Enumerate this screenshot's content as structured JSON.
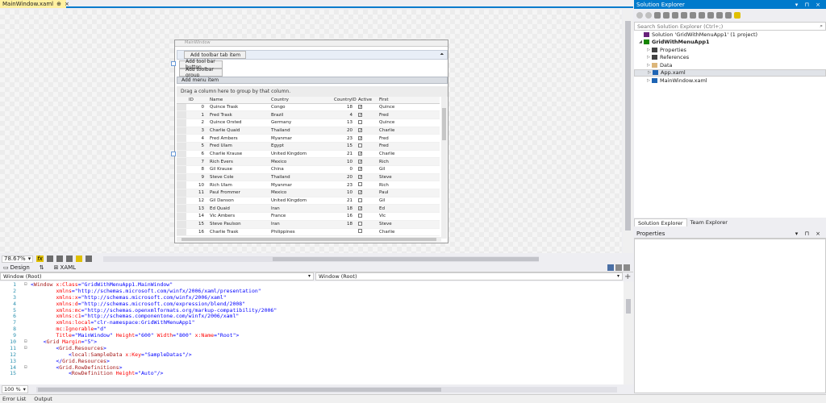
{
  "tabs": {
    "doc_tab": "MainWindow.xaml",
    "pin": "⊕",
    "close": "×"
  },
  "designer": {
    "window_title": "MainWindow",
    "toolbar_tab": "Add toolbar tab item",
    "toolbar_button": "Add tool bar button",
    "toolbar_group": "Add toolbar group",
    "menu_item": "Add menu item",
    "group_hint": "Drag a column here to group by that column.",
    "columns": [
      "ID",
      "Name",
      "Country",
      "CountryID",
      "Active",
      "First"
    ],
    "rows": [
      {
        "id": "0",
        "name": "Quince Trask",
        "country": "Congo",
        "cid": "18",
        "active": true,
        "first": "Quince"
      },
      {
        "id": "1",
        "name": "Fred Trask",
        "country": "Brazil",
        "cid": "4",
        "active": true,
        "first": "Fred"
      },
      {
        "id": "2",
        "name": "Quince Orsted",
        "country": "Germany",
        "cid": "13",
        "active": false,
        "first": "Quince"
      },
      {
        "id": "3",
        "name": "Charlie Quaid",
        "country": "Thailand",
        "cid": "20",
        "active": true,
        "first": "Charlie"
      },
      {
        "id": "4",
        "name": "Fred Ambers",
        "country": "Myanmar",
        "cid": "23",
        "active": true,
        "first": "Fred"
      },
      {
        "id": "5",
        "name": "Fred Ulam",
        "country": "Egypt",
        "cid": "15",
        "active": false,
        "first": "Fred"
      },
      {
        "id": "6",
        "name": "Charlie Krause",
        "country": "United Kingdom",
        "cid": "21",
        "active": true,
        "first": "Charlie"
      },
      {
        "id": "7",
        "name": "Rich Evers",
        "country": "Mexico",
        "cid": "10",
        "active": true,
        "first": "Rich"
      },
      {
        "id": "8",
        "name": "Gil Krause",
        "country": "China",
        "cid": "0",
        "active": true,
        "first": "Gil"
      },
      {
        "id": "9",
        "name": "Steve Cole",
        "country": "Thailand",
        "cid": "20",
        "active": true,
        "first": "Steve"
      },
      {
        "id": "10",
        "name": "Rich Ulam",
        "country": "Myanmar",
        "cid": "23",
        "active": false,
        "first": "Rich"
      },
      {
        "id": "11",
        "name": "Paul Frommer",
        "country": "Mexico",
        "cid": "10",
        "active": true,
        "first": "Paul"
      },
      {
        "id": "12",
        "name": "Gil Danson",
        "country": "United Kingdom",
        "cid": "21",
        "active": false,
        "first": "Gil"
      },
      {
        "id": "13",
        "name": "Ed Quaid",
        "country": "Iran",
        "cid": "18",
        "active": true,
        "first": "Ed"
      },
      {
        "id": "14",
        "name": "Vic Ambers",
        "country": "France",
        "cid": "16",
        "active": false,
        "first": "Vic"
      },
      {
        "id": "15",
        "name": "Steve Paulson",
        "country": "Iran",
        "cid": "18",
        "active": false,
        "first": "Steve"
      },
      {
        "id": "16",
        "name": "Charlie Trask",
        "country": "Philippines",
        "cid": "",
        "active": false,
        "first": "Charlie"
      }
    ]
  },
  "zoom": {
    "value": "78.67%",
    "fx": "fx"
  },
  "view_tabs": {
    "design": "Design",
    "swap": "⇅",
    "xaml": "XAML"
  },
  "selectors": {
    "left": "Window (Root)",
    "right": "Window (Root)"
  },
  "code_zoom": "100 %",
  "code_lines": [
    {
      "n": "1",
      "fold": "⊟",
      "indent": "",
      "parts": [
        [
          "pun",
          "<"
        ],
        [
          "tag",
          "Window"
        ],
        [
          "att",
          " x:Class"
        ],
        [
          "pun",
          "=\""
        ],
        [
          "val",
          "GridWithMenuApp1.MainWindow"
        ],
        [
          "pun",
          "\""
        ]
      ]
    },
    {
      "n": "2",
      "fold": "",
      "indent": "        ",
      "parts": [
        [
          "att",
          "xmlns"
        ],
        [
          "pun",
          "=\""
        ],
        [
          "val",
          "http://schemas.microsoft.com/winfx/2006/xaml/presentation"
        ],
        [
          "pun",
          "\""
        ]
      ]
    },
    {
      "n": "3",
      "fold": "",
      "indent": "        ",
      "parts": [
        [
          "att",
          "xmlns:x"
        ],
        [
          "pun",
          "=\""
        ],
        [
          "val",
          "http://schemas.microsoft.com/winfx/2006/xaml"
        ],
        [
          "pun",
          "\""
        ]
      ]
    },
    {
      "n": "4",
      "fold": "",
      "indent": "        ",
      "parts": [
        [
          "att",
          "xmlns:d"
        ],
        [
          "pun",
          "=\""
        ],
        [
          "val",
          "http://schemas.microsoft.com/expression/blend/2008"
        ],
        [
          "pun",
          "\""
        ]
      ]
    },
    {
      "n": "5",
      "fold": "",
      "indent": "        ",
      "parts": [
        [
          "att",
          "xmlns:mc"
        ],
        [
          "pun",
          "=\""
        ],
        [
          "val",
          "http://schemas.openxmlformats.org/markup-compatibility/2006"
        ],
        [
          "pun",
          "\""
        ]
      ]
    },
    {
      "n": "6",
      "fold": "",
      "indent": "        ",
      "parts": [
        [
          "att",
          "xmlns:c1"
        ],
        [
          "pun",
          "=\""
        ],
        [
          "val",
          "http://schemas.componentone.com/winfx/2006/xaml"
        ],
        [
          "pun",
          "\""
        ]
      ]
    },
    {
      "n": "7",
      "fold": "",
      "indent": "        ",
      "parts": [
        [
          "att",
          "xmlns:local"
        ],
        [
          "pun",
          "=\""
        ],
        [
          "val",
          "clr-namespace:GridWithMenuApp1"
        ],
        [
          "pun",
          "\""
        ]
      ]
    },
    {
      "n": "8",
      "fold": "",
      "indent": "        ",
      "parts": [
        [
          "att",
          "mc:Ignorable"
        ],
        [
          "pun",
          "=\""
        ],
        [
          "val",
          "d"
        ],
        [
          "pun",
          "\""
        ]
      ]
    },
    {
      "n": "9",
      "fold": "",
      "indent": "        ",
      "parts": [
        [
          "att",
          "Title"
        ],
        [
          "pun",
          "=\""
        ],
        [
          "val",
          "MainWindow"
        ],
        [
          "pun",
          "\""
        ],
        [
          "att",
          " Height"
        ],
        [
          "pun",
          "=\""
        ],
        [
          "val",
          "600"
        ],
        [
          "pun",
          "\""
        ],
        [
          "att",
          " Width"
        ],
        [
          "pun",
          "=\""
        ],
        [
          "val",
          "800"
        ],
        [
          "pun",
          "\""
        ],
        [
          "att",
          " x:Name"
        ],
        [
          "pun",
          "=\""
        ],
        [
          "val",
          "Root"
        ],
        [
          "pun",
          "\">"
        ]
      ]
    },
    {
      "n": "10",
      "fold": "⊟",
      "indent": "    ",
      "parts": [
        [
          "pun",
          "<"
        ],
        [
          "tag",
          "Grid"
        ],
        [
          "att",
          " Margin"
        ],
        [
          "pun",
          "=\""
        ],
        [
          "val",
          "5"
        ],
        [
          "pun",
          "\">"
        ]
      ]
    },
    {
      "n": "11",
      "fold": "⊟",
      "indent": "        ",
      "parts": [
        [
          "pun",
          "<"
        ],
        [
          "tag",
          "Grid.Resources"
        ],
        [
          "pun",
          ">"
        ]
      ]
    },
    {
      "n": "12",
      "fold": "",
      "indent": "            ",
      "parts": [
        [
          "pun",
          "<"
        ],
        [
          "tag",
          "local:SampleData"
        ],
        [
          "att",
          " x:Key"
        ],
        [
          "pun",
          "=\""
        ],
        [
          "val",
          "SampleDatas"
        ],
        [
          "pun",
          "\"/>"
        ]
      ]
    },
    {
      "n": "13",
      "fold": "",
      "indent": "        ",
      "parts": [
        [
          "pun",
          "</"
        ],
        [
          "tag",
          "Grid.Resources"
        ],
        [
          "pun",
          ">"
        ]
      ]
    },
    {
      "n": "14",
      "fold": "⊟",
      "indent": "        ",
      "parts": [
        [
          "pun",
          "<"
        ],
        [
          "tag",
          "Grid.RowDefinitions"
        ],
        [
          "pun",
          ">"
        ]
      ]
    },
    {
      "n": "15",
      "fold": "",
      "indent": "            ",
      "parts": [
        [
          "pun",
          "<"
        ],
        [
          "tag",
          "RowDefinition"
        ],
        [
          "att",
          " Height"
        ],
        [
          "pun",
          "=\""
        ],
        [
          "val",
          "Auto"
        ],
        [
          "pun",
          "\"/>"
        ]
      ]
    }
  ],
  "status": {
    "error_list": "Error List",
    "output": "Output"
  },
  "solution_explorer": {
    "title": "Solution Explorer",
    "title_buttons": "▾ ⊓ ×",
    "search_placeholder": "Search Solution Explorer (Ctrl+;)",
    "search_icon": "⌕",
    "tree": [
      {
        "label": "Solution 'GridWithMenuApp1' (1 project)",
        "level": 0,
        "arrow": "",
        "bold": false,
        "icon": "solution-icon",
        "color": "#68217a"
      },
      {
        "label": "GridWithMenuApp1",
        "level": 0,
        "arrow": "◢",
        "bold": true,
        "icon": "project-icon",
        "color": "#178600"
      },
      {
        "label": "Properties",
        "level": 1,
        "arrow": "▷",
        "bold": false,
        "icon": "wrench-icon",
        "color": "#424242"
      },
      {
        "label": "References",
        "level": 1,
        "arrow": "▷",
        "bold": false,
        "icon": "references-icon",
        "color": "#424242"
      },
      {
        "label": "Data",
        "level": 1,
        "arrow": "▷",
        "bold": false,
        "icon": "folder-icon",
        "color": "#dcb67a"
      },
      {
        "label": "App.xaml",
        "level": 1,
        "arrow": "▷",
        "bold": false,
        "icon": "xaml-file-icon",
        "color": "#1e64b4",
        "selected": true
      },
      {
        "label": "MainWindow.xaml",
        "level": 1,
        "arrow": "▷",
        "bold": false,
        "icon": "xaml-file-icon",
        "color": "#1e64b4"
      }
    ],
    "tabs": [
      "Solution Explorer",
      "Team Explorer"
    ]
  },
  "properties": {
    "title": "Properties",
    "title_buttons": "▾ ⊓ ×"
  },
  "colors": {
    "accent": "#007acc",
    "doc_tab": "#fff0a0"
  }
}
